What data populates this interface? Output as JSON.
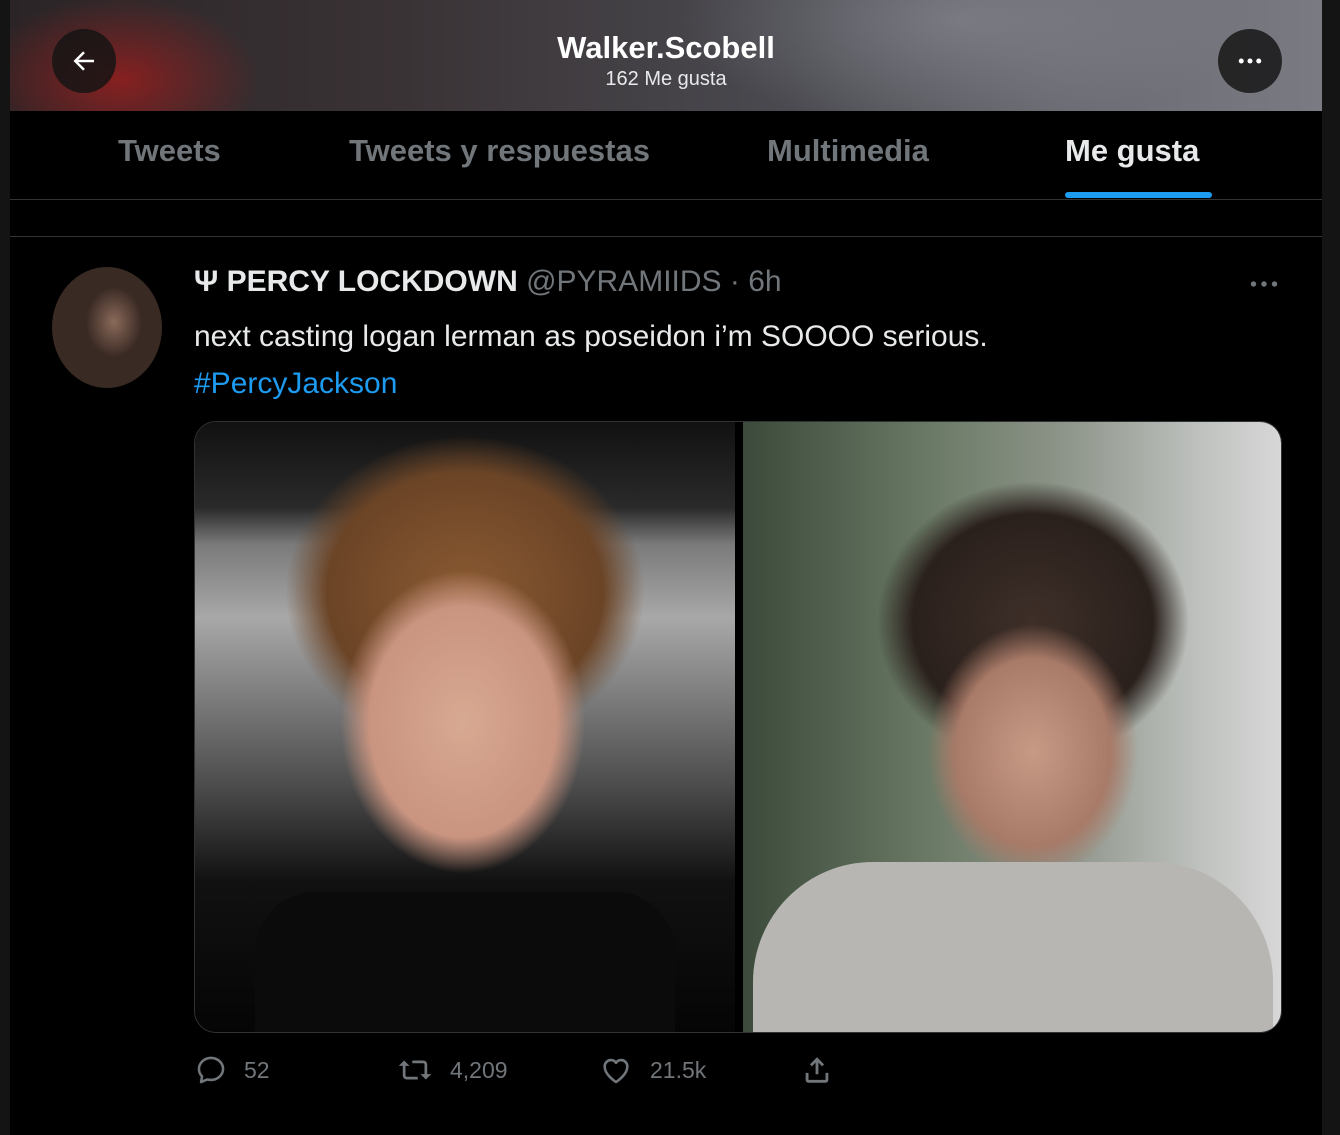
{
  "header": {
    "title": "Walker.Scobell",
    "subtitle": "162 Me gusta",
    "back_icon": "arrow-left-icon",
    "more_icon": "more-horizontal-icon"
  },
  "tabs": [
    {
      "label": "Tweets",
      "active": false
    },
    {
      "label": "Tweets y respuestas",
      "active": false
    },
    {
      "label": "Multimedia",
      "active": false
    },
    {
      "label": "Me gusta",
      "active": true
    }
  ],
  "tweet": {
    "name": "Ψ PERCY LOCKDOWN",
    "handle": "@PYRAMIIDS",
    "separator": "·",
    "time": "6h",
    "text": "next casting logan lerman as poseidon i’m SOOOO serious.",
    "hashtag": "#PercyJackson",
    "actions": {
      "replies": "52",
      "retweets": "4,209",
      "likes": "21.5k"
    }
  },
  "colors": {
    "accent": "#1d9bf0",
    "background": "#000000",
    "muted": "#71767b"
  }
}
